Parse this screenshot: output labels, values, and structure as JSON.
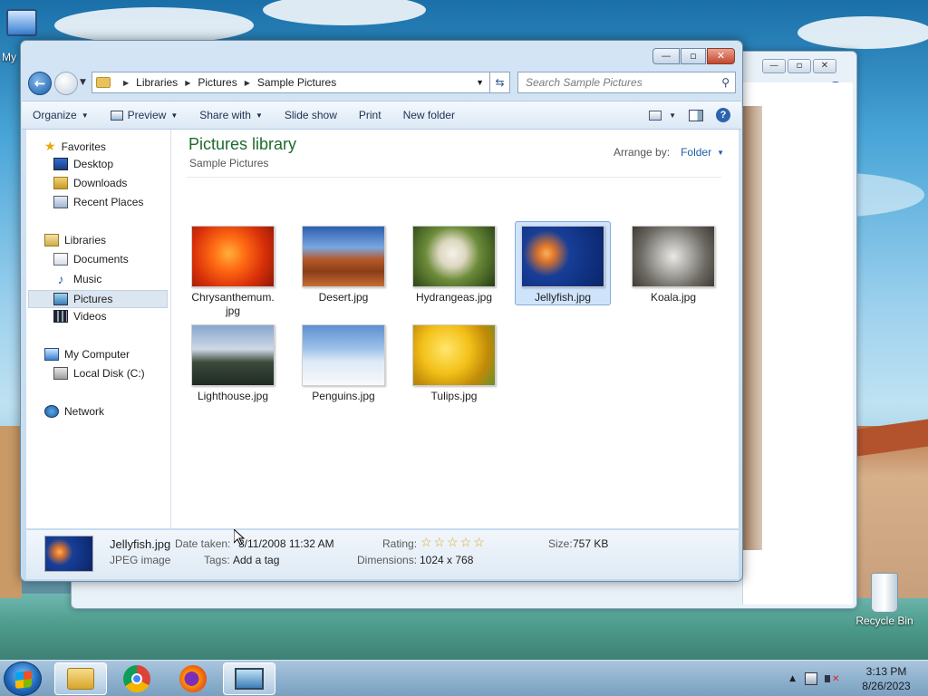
{
  "desktop": {
    "icons": [
      {
        "label": "My"
      },
      {
        "label": "Recycle Bin"
      }
    ]
  },
  "explorer": {
    "controls": {
      "minimize": "—",
      "maximize": "▫",
      "close": "✕"
    },
    "breadcrumb": [
      "Libraries",
      "Pictures",
      "Sample Pictures"
    ],
    "search_placeholder": "Search Sample Pictures",
    "toolbar": {
      "organize": "Organize",
      "preview": "Preview",
      "share_with": "Share with",
      "slide_show": "Slide show",
      "print": "Print",
      "new_folder": "New folder"
    },
    "nav": {
      "favorites": "Favorites",
      "desktop": "Desktop",
      "downloads": "Downloads",
      "recent_places": "Recent Places",
      "libraries": "Libraries",
      "documents": "Documents",
      "music": "Music",
      "pictures": "Pictures",
      "videos": "Videos",
      "my_computer": "My Computer",
      "local_disk": "Local Disk (C:)",
      "network": "Network"
    },
    "content": {
      "title": "Pictures library",
      "subtitle": "Sample Pictures",
      "arrange_label": "Arrange by:",
      "arrange_value": "Folder",
      "files": [
        {
          "name": "Chrysanthemum.\njpg"
        },
        {
          "name": "Desert.jpg"
        },
        {
          "name": "Hydrangeas.jpg"
        },
        {
          "name": "Jellyfish.jpg"
        },
        {
          "name": "Koala.jpg"
        },
        {
          "name": "Lighthouse.jpg"
        },
        {
          "name": "Penguins.jpg"
        },
        {
          "name": "Tulips.jpg"
        }
      ]
    },
    "details": {
      "filename": "Jellyfish.jpg",
      "filetype": "JPEG image",
      "date_taken_label": "Date taken:",
      "date_taken_value": "3/11/2008 11:32 AM",
      "tags_label": "Tags:",
      "tags_value": "Add a tag",
      "rating_label": "Rating:",
      "rating_stars": "☆☆☆☆☆",
      "dimensions_label": "Dimensions:",
      "dimensions_value": "1024 x 768",
      "size_label": "Size:",
      "size_value": "757 KB"
    }
  },
  "taskbar": {
    "time": "3:13 PM",
    "date": "8/26/2023"
  }
}
